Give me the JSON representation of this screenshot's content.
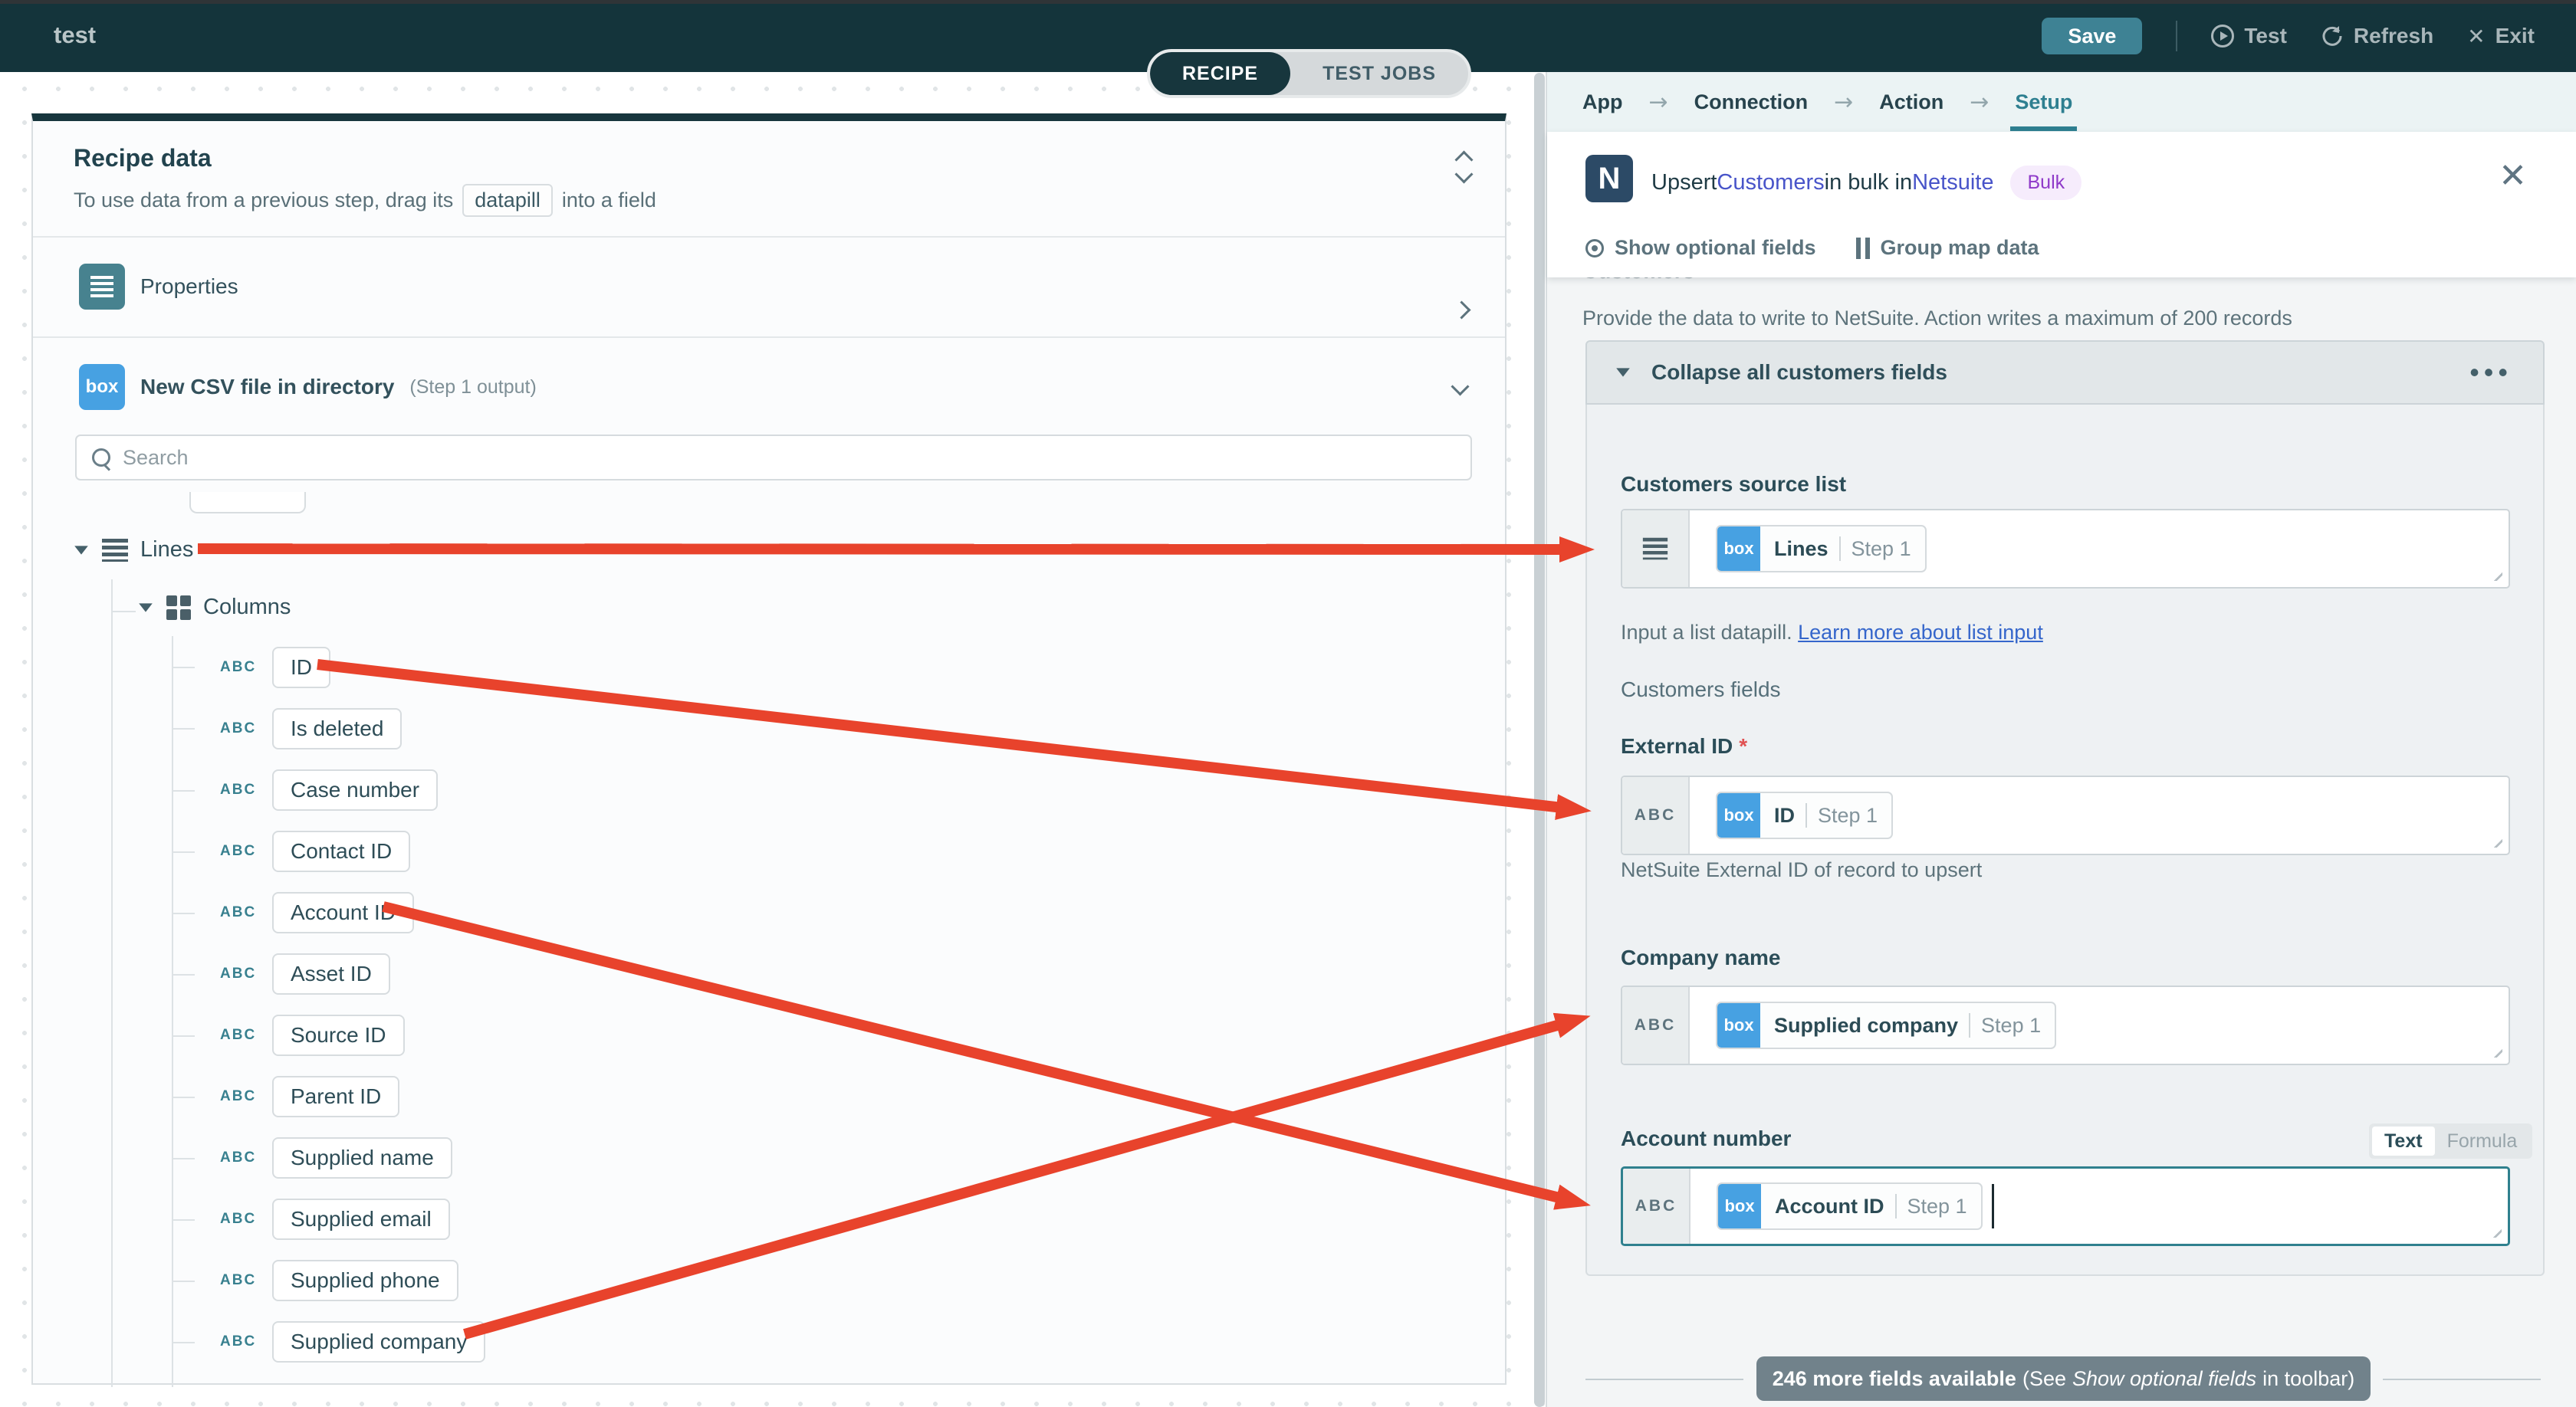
{
  "topbar": {
    "title": "test",
    "save_label": "Save",
    "test_label": "Test",
    "refresh_label": "Refresh",
    "exit_label": "Exit"
  },
  "tabs": {
    "recipe": "RECIPE",
    "test_jobs": "TEST JOBS"
  },
  "recipe_panel": {
    "title": "Recipe data",
    "hint_prefix": "To use data from a previous step, drag its",
    "hint_pill": "datapill",
    "hint_suffix": "into a field",
    "properties_label": "Properties",
    "csv_label": "New CSV file in directory",
    "csv_sub": "(Step 1 output)",
    "search_placeholder": "Search",
    "tree": {
      "root": "Lines",
      "group": "Columns",
      "type_label": "ABC",
      "columns": [
        "ID",
        "Is deleted",
        "Case number",
        "Contact ID",
        "Account ID",
        "Asset ID",
        "Source ID",
        "Parent ID",
        "Supplied name",
        "Supplied email",
        "Supplied phone",
        "Supplied company"
      ]
    }
  },
  "setup_panel": {
    "breadcrumb": [
      "App",
      "Connection",
      "Action",
      "Setup"
    ],
    "title": {
      "p1": "Upsert ",
      "link1": "Customers",
      "p2": " in bulk in ",
      "link2": "Netsuite"
    },
    "bulk_badge": "Bulk",
    "toolbar": {
      "show_optional": "Show optional fields",
      "group_map": "Group map data"
    },
    "section_label": "Customers",
    "section_desc": "Provide the data to write to NetSuite. Action writes a maximum of 200 records",
    "collapse_header": "Collapse all customers fields",
    "box_label": "box",
    "fields": {
      "source_list": {
        "label": "Customers source list",
        "pill_name": "Lines",
        "pill_step": "Step 1",
        "help_plain": "Input a list datapill. ",
        "help_link": "Learn more about list input"
      },
      "fields_heading": "Customers fields",
      "external_id": {
        "label": "External ID",
        "required_mark": "*",
        "pill_name": "ID",
        "pill_step": "Step 1",
        "help": "NetSuite External ID of record to upsert"
      },
      "company_name": {
        "label": "Company name",
        "pill_name": "Supplied company",
        "pill_step": "Step 1"
      },
      "account_number": {
        "label": "Account number",
        "toggle_text": "Text",
        "toggle_formula": "Formula",
        "pill_name": "Account ID",
        "pill_step": "Step 1"
      }
    },
    "more_note": {
      "bold": "246 more fields available",
      "p1": "(See ",
      "italic": "Show optional fields",
      "p2": " in toolbar)"
    }
  },
  "colors": {
    "topbar": "#14343b",
    "accent_teal": "#2f808e",
    "save_button": "#3e8294",
    "arrow_red": "#e8432c",
    "box_blue": "#47a1e2",
    "link_blue": "#3566cb",
    "title_link": "#4854c9",
    "bulk_purple": "#8f3ac9",
    "focus_border": "#2f808e"
  }
}
